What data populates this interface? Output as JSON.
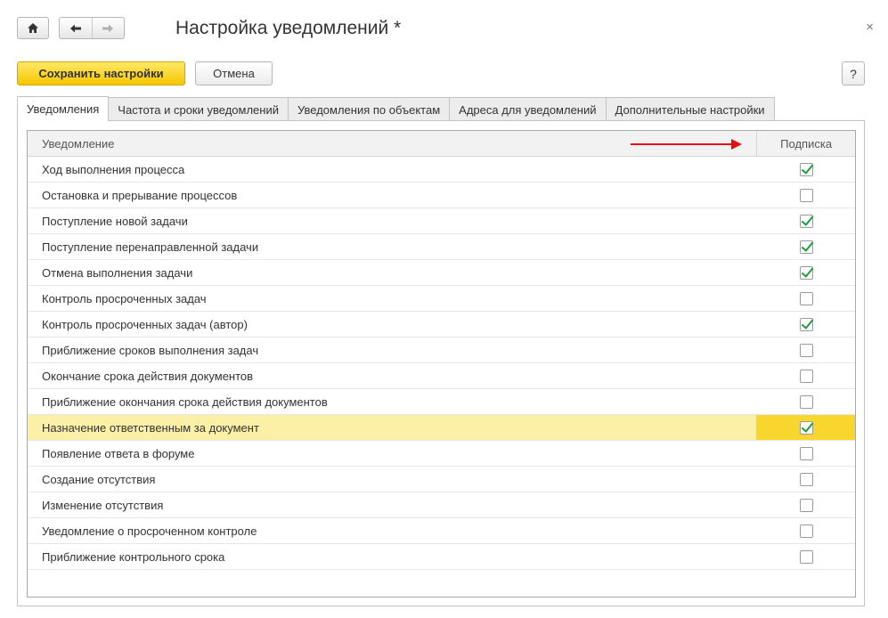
{
  "header": {
    "title": "Настройка уведомлений *",
    "close_glyph": "×"
  },
  "toolbar": {
    "save_label": "Сохранить настройки",
    "cancel_label": "Отмена",
    "help_label": "?"
  },
  "tabs": [
    {
      "label": "Уведомления",
      "active": true
    },
    {
      "label": "Частота и сроки уведомлений",
      "active": false
    },
    {
      "label": "Уведомления по объектам",
      "active": false
    },
    {
      "label": "Адреса для уведомлений",
      "active": false
    },
    {
      "label": "Дополнительные настройки",
      "active": false
    }
  ],
  "grid": {
    "columns": {
      "name": "Уведомление",
      "subscription": "Подписка"
    },
    "selected_index": 10,
    "rows": [
      {
        "name": "Ход выполнения процесса",
        "subscribed": true
      },
      {
        "name": "Остановка и прерывание процессов",
        "subscribed": false
      },
      {
        "name": "Поступление новой задачи",
        "subscribed": true
      },
      {
        "name": "Поступление перенаправленной задачи",
        "subscribed": true
      },
      {
        "name": "Отмена выполнения задачи",
        "subscribed": true
      },
      {
        "name": "Контроль просроченных задач",
        "subscribed": false
      },
      {
        "name": "Контроль просроченных задач (автор)",
        "subscribed": true
      },
      {
        "name": "Приближение сроков выполнения задач",
        "subscribed": false
      },
      {
        "name": "Окончание срока действия документов",
        "subscribed": false
      },
      {
        "name": "Приближение окончания срока действия документов",
        "subscribed": false
      },
      {
        "name": "Назначение ответственным за документ",
        "subscribed": true
      },
      {
        "name": "Появление ответа в форуме",
        "subscribed": false
      },
      {
        "name": "Создание отсутствия",
        "subscribed": false
      },
      {
        "name": "Изменение отсутствия",
        "subscribed": false
      },
      {
        "name": "Уведомление о просроченном контроле",
        "subscribed": false
      },
      {
        "name": "Приближение контрольного срока",
        "subscribed": false
      }
    ]
  },
  "colors": {
    "accent_yellow": "#f5c600",
    "selected_row": "#fbf0a6",
    "selected_cell": "#f8d62e",
    "check_green": "#1e9b3c",
    "annotation_arrow": "#e01010"
  },
  "icons": {
    "home": "home-icon",
    "back": "arrow-left-icon",
    "forward": "arrow-right-icon",
    "close": "close-icon",
    "check": "checkmark-icon"
  }
}
